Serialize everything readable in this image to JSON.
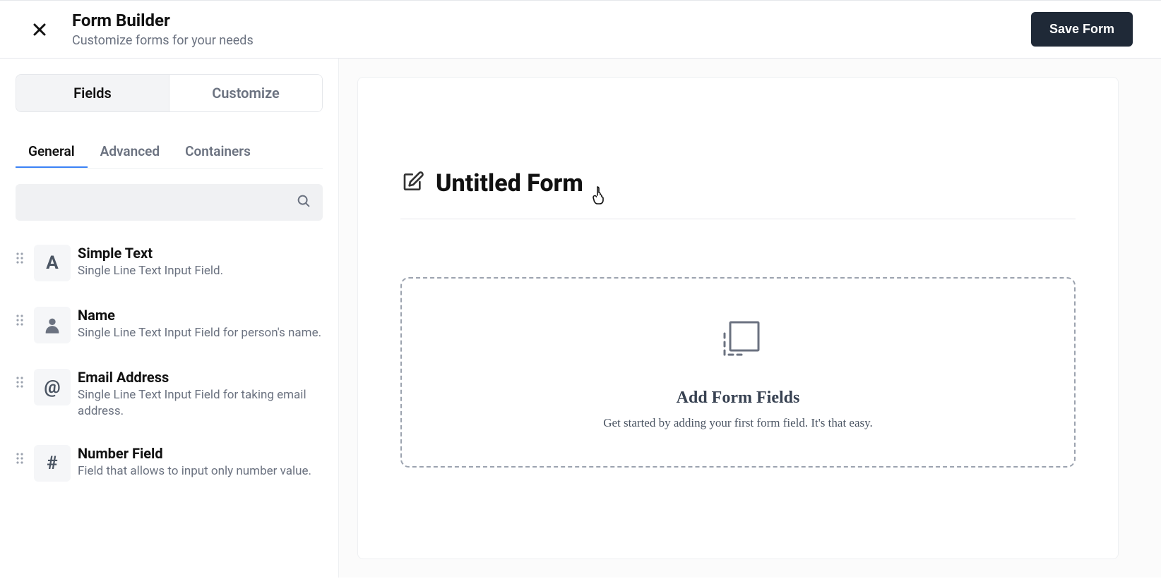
{
  "header": {
    "title": "Form Builder",
    "subtitle": "Customize forms for your needs",
    "save_label": "Save Form"
  },
  "sidebar": {
    "tabs": {
      "fields": "Fields",
      "customize": "Customize"
    },
    "subtabs": {
      "general": "General",
      "advanced": "Advanced",
      "containers": "Containers"
    },
    "search_placeholder": "",
    "fields": [
      {
        "icon": "text-icon",
        "title": "Simple Text",
        "desc": "Single Line Text Input Field."
      },
      {
        "icon": "user-icon",
        "title": "Name",
        "desc": "Single Line Text Input Field for person's name."
      },
      {
        "icon": "at-icon",
        "title": "Email Address",
        "desc": "Single Line Text Input Field for taking email address."
      },
      {
        "icon": "hash-icon",
        "title": "Number Field",
        "desc": "Field that allows to input only number value."
      }
    ]
  },
  "canvas": {
    "form_title": "Untitled Form",
    "dropzone_title": "Add Form Fields",
    "dropzone_desc": "Get started by adding your first form field. It's that easy."
  }
}
